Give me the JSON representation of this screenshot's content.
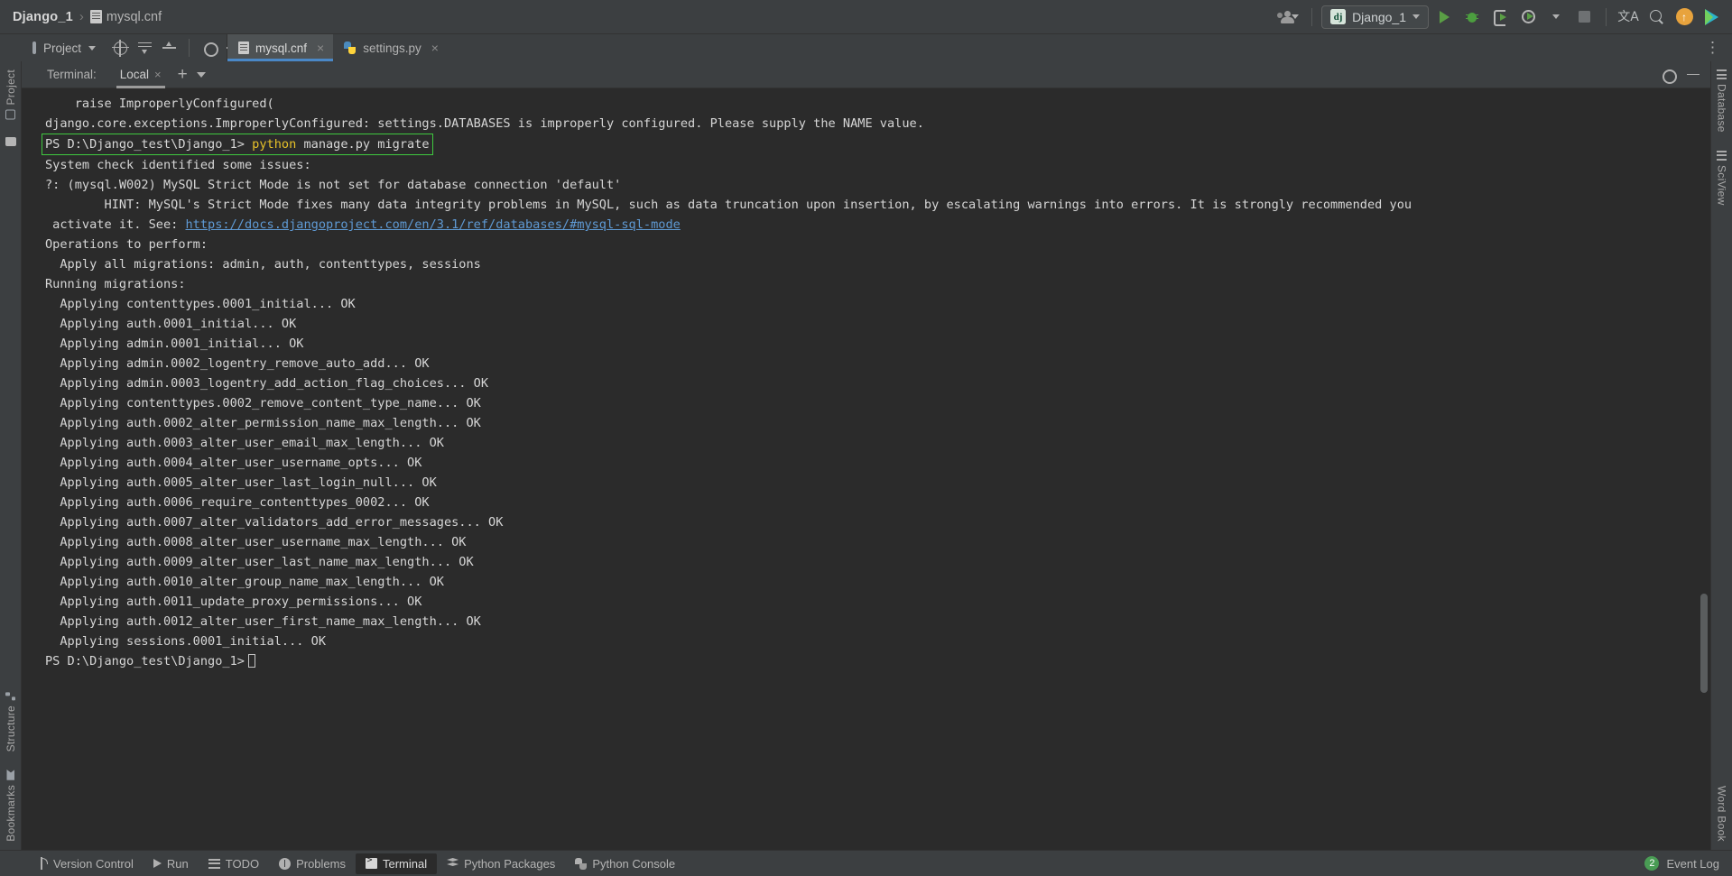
{
  "titlebar": {
    "breadcrumb_project": "Django_1",
    "breadcrumb_separator": "›",
    "breadcrumb_file": "mysql.cnf",
    "run_config": "Django_1",
    "run_config_badge": "dj",
    "icons": {
      "user": "user-settings-icon",
      "run": "run-icon",
      "debug": "debug-icon",
      "coverage": "run-with-coverage-icon",
      "profile": "profile-icon",
      "stop": "stop-icon",
      "translate": "translate-icon",
      "search": "search-everywhere-icon",
      "update": "update-available-icon",
      "ide": "ide-logo-icon"
    },
    "update_glyph": "↑"
  },
  "secondbar": {
    "project_label": "Project",
    "tool_icons": [
      "locate-icon",
      "collapse-all-icon",
      "expand-all-icon",
      "settings-gear-icon",
      "hide-icon"
    ],
    "more_glyph": "⋮",
    "tabs": [
      {
        "label": "mysql.cnf",
        "icon": "cnf-file-icon",
        "active": true,
        "close": "×"
      },
      {
        "label": "settings.py",
        "icon": "python-file-icon",
        "active": false,
        "close": "×"
      }
    ]
  },
  "left_rail": {
    "top": [
      {
        "label": "Project",
        "icon": "project-panel-icon"
      },
      {
        "label": "",
        "icon": "folder-icon"
      }
    ],
    "bottom": [
      {
        "label": "Structure",
        "icon": "structure-icon"
      },
      {
        "label": "Bookmarks",
        "icon": "bookmarks-icon"
      }
    ]
  },
  "right_rail": {
    "items": [
      {
        "label": "Database",
        "icon": "database-icon"
      },
      {
        "label": "SciView",
        "icon": "sciview-icon"
      },
      {
        "label": "Word Book",
        "icon": "word-book-icon"
      }
    ]
  },
  "terminal": {
    "title": "Terminal:",
    "session_tab": "Local",
    "session_close": "×",
    "add_glyph": "+",
    "header_icons": [
      "settings-gear-icon",
      "hide-terminal-icon"
    ],
    "prompt_path": "PS D:\\Django_test\\Django_1>",
    "command": " python manage.py migrate",
    "command_keyword": "python",
    "command_rest": " manage.py migrate",
    "highlight_color": "#3fc93f",
    "link_color": "#5f9ad4",
    "lines": [
      {
        "text": "    raise ImproperlyConfigured("
      },
      {
        "text": "django.core.exceptions.ImproperlyConfigured: settings.DATABASES is improperly configured. Please supply the NAME value."
      },
      {
        "type": "command"
      },
      {
        "text": "System check identified some issues:"
      },
      {
        "text": ""
      },
      {
        "text": "?: (mysql.W002) MySQL Strict Mode is not set for database connection 'default'"
      },
      {
        "text": "        HINT: MySQL's Strict Mode fixes many data integrity problems in MySQL, such as data truncation upon insertion, by escalating warnings into errors. It is strongly recommended you"
      },
      {
        "type": "link_line",
        "prefix": " activate it. See: ",
        "link": "https://docs.djangoproject.com/en/3.1/ref/databases/#mysql-sql-mode"
      },
      {
        "text": "Operations to perform:"
      },
      {
        "text": "  Apply all migrations: admin, auth, contenttypes, sessions"
      },
      {
        "text": "Running migrations:"
      },
      {
        "text": "  Applying contenttypes.0001_initial... OK"
      },
      {
        "text": "  Applying auth.0001_initial... OK"
      },
      {
        "text": "  Applying admin.0001_initial... OK"
      },
      {
        "text": "  Applying admin.0002_logentry_remove_auto_add... OK"
      },
      {
        "text": "  Applying admin.0003_logentry_add_action_flag_choices... OK"
      },
      {
        "text": "  Applying contenttypes.0002_remove_content_type_name... OK"
      },
      {
        "text": "  Applying auth.0002_alter_permission_name_max_length... OK"
      },
      {
        "text": "  Applying auth.0003_alter_user_email_max_length... OK"
      },
      {
        "text": "  Applying auth.0004_alter_user_username_opts... OK"
      },
      {
        "text": "  Applying auth.0005_alter_user_last_login_null... OK"
      },
      {
        "text": "  Applying auth.0006_require_contenttypes_0002... OK"
      },
      {
        "text": "  Applying auth.0007_alter_validators_add_error_messages... OK"
      },
      {
        "text": "  Applying auth.0008_alter_user_username_max_length... OK"
      },
      {
        "text": "  Applying auth.0009_alter_user_last_name_max_length... OK"
      },
      {
        "text": "  Applying auth.0010_alter_group_name_max_length... OK"
      },
      {
        "text": "  Applying auth.0011_update_proxy_permissions... OK"
      },
      {
        "text": "  Applying auth.0012_alter_user_first_name_max_length... OK"
      },
      {
        "text": "  Applying sessions.0001_initial... OK"
      },
      {
        "type": "prompt_cursor",
        "prompt": "PS D:\\Django_test\\Django_1>"
      }
    ]
  },
  "statusbar": {
    "items": [
      {
        "label": "Version Control",
        "icon": "version-control-icon",
        "active": false
      },
      {
        "label": "Run",
        "icon": "run-icon",
        "active": false
      },
      {
        "label": "TODO",
        "icon": "todo-icon",
        "active": false
      },
      {
        "label": "Problems",
        "icon": "problems-icon",
        "active": false
      },
      {
        "label": "Terminal",
        "icon": "terminal-icon",
        "active": true
      },
      {
        "label": "Python Packages",
        "icon": "python-packages-icon",
        "active": false
      },
      {
        "label": "Python Console",
        "icon": "python-console-icon",
        "active": false
      }
    ],
    "event_log_label": "Event Log",
    "event_log_count": "2"
  }
}
